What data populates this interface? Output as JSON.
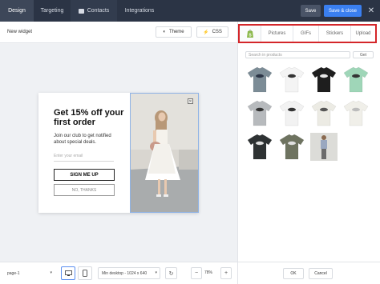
{
  "topbar": {
    "tabs": [
      {
        "label": "Design",
        "active": true
      },
      {
        "label": "Targeting",
        "active": false
      },
      {
        "label": "Contacts",
        "active": false
      },
      {
        "label": "Integrations",
        "active": false
      }
    ],
    "save_label": "Save",
    "save_close_label": "Save & close",
    "close_icon": "close-icon"
  },
  "editor": {
    "widget_title": "New widget",
    "theme_label": "Theme",
    "css_label": "CSS"
  },
  "popup": {
    "headline": "Get 15% off your first order",
    "subtext": "Join our club to get notified about special deals.",
    "email_placeholder": "Enter your email",
    "signup_label": "SIGN ME UP",
    "nothanks_label": "NO, THANKS"
  },
  "bottombar": {
    "page": "page-1",
    "resolution": "Min desktop - 1024 x 640",
    "zoom_minus": "−",
    "zoom": "78%",
    "zoom_plus": "+"
  },
  "media_panel": {
    "sources": [
      {
        "label": "",
        "icon": "shopify-icon"
      },
      {
        "label": "Pictures"
      },
      {
        "label": "GIFs"
      },
      {
        "label": "Stickers"
      },
      {
        "label": "Upload"
      }
    ],
    "search_placeholder": "Search in products",
    "search_button": "Get",
    "products": [
      {
        "name": "tshirt-gray",
        "color": "#7c8c96",
        "print": "#2b3445"
      },
      {
        "name": "tshirt-white",
        "color": "#f4f4f4",
        "print": "#333333"
      },
      {
        "name": "tshirt-black",
        "color": "#1e1e1e",
        "print": "#e9e9e9"
      },
      {
        "name": "tshirt-mint",
        "color": "#9fd6b8",
        "print": "#333333"
      },
      {
        "name": "tshirt-heather",
        "color": "#b7babd",
        "print": "#333333"
      },
      {
        "name": "tshirt-white-2",
        "color": "#f2f2f2",
        "print": "#333333"
      },
      {
        "name": "tshirt-cream-logo",
        "color": "#ecebe4",
        "print": "#555555"
      },
      {
        "name": "tshirt-cream",
        "color": "#f0efe9",
        "print": "#bbbbbb"
      },
      {
        "name": "tshirt-charcoal",
        "color": "#2e3233",
        "print": "#e0e0e0"
      },
      {
        "name": "tshirt-olive",
        "color": "#6e7360",
        "print": "#e0e0e0"
      },
      {
        "name": "model-photo",
        "color": "#9aa8c0",
        "print": "#6b6b6b"
      }
    ],
    "ok_label": "OK",
    "cancel_label": "Cancel"
  },
  "colors": {
    "topbar_bg": "#2b3445",
    "accent": "#3a7ff0",
    "highlight": "#d4262a"
  }
}
